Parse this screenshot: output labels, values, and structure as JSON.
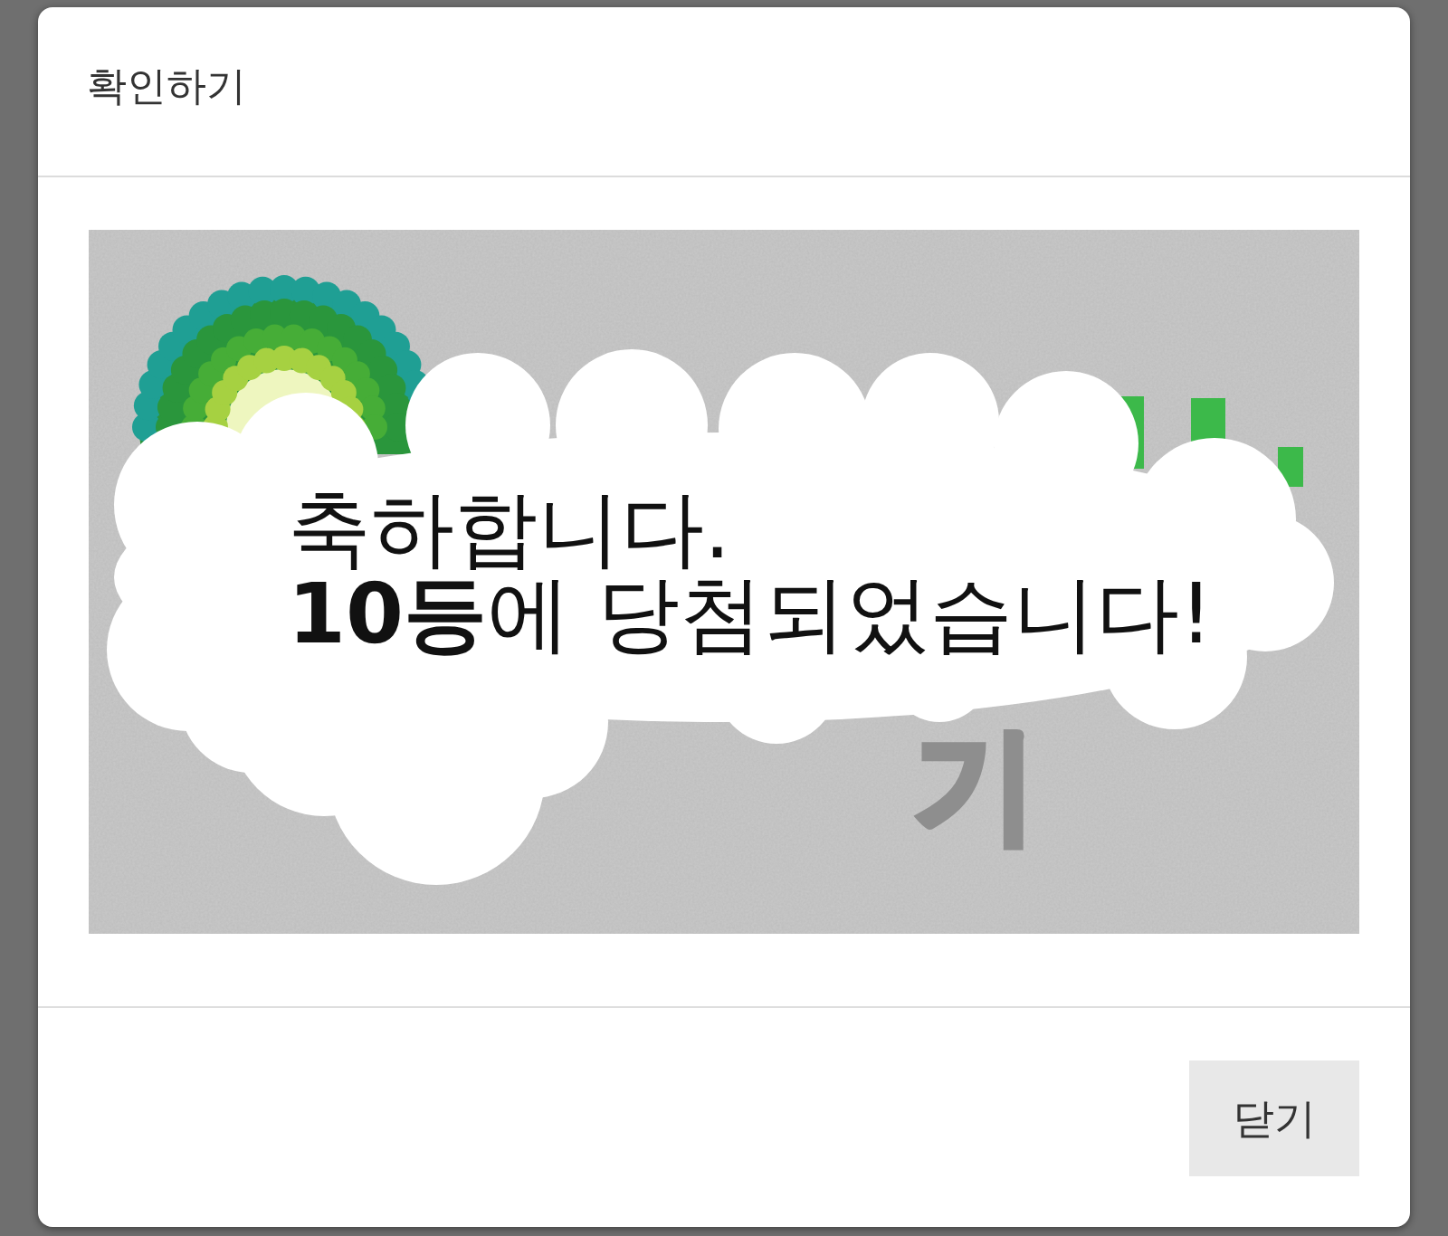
{
  "dialog": {
    "title": "확인하기"
  },
  "scratch_card": {
    "cover_text": "기",
    "result_lines": [
      "축하합니다.",
      "**10등**에 당첨되었습니다!"
    ]
  },
  "footer": {
    "buttons": [
      {
        "label": "닫기"
      }
    ]
  }
}
